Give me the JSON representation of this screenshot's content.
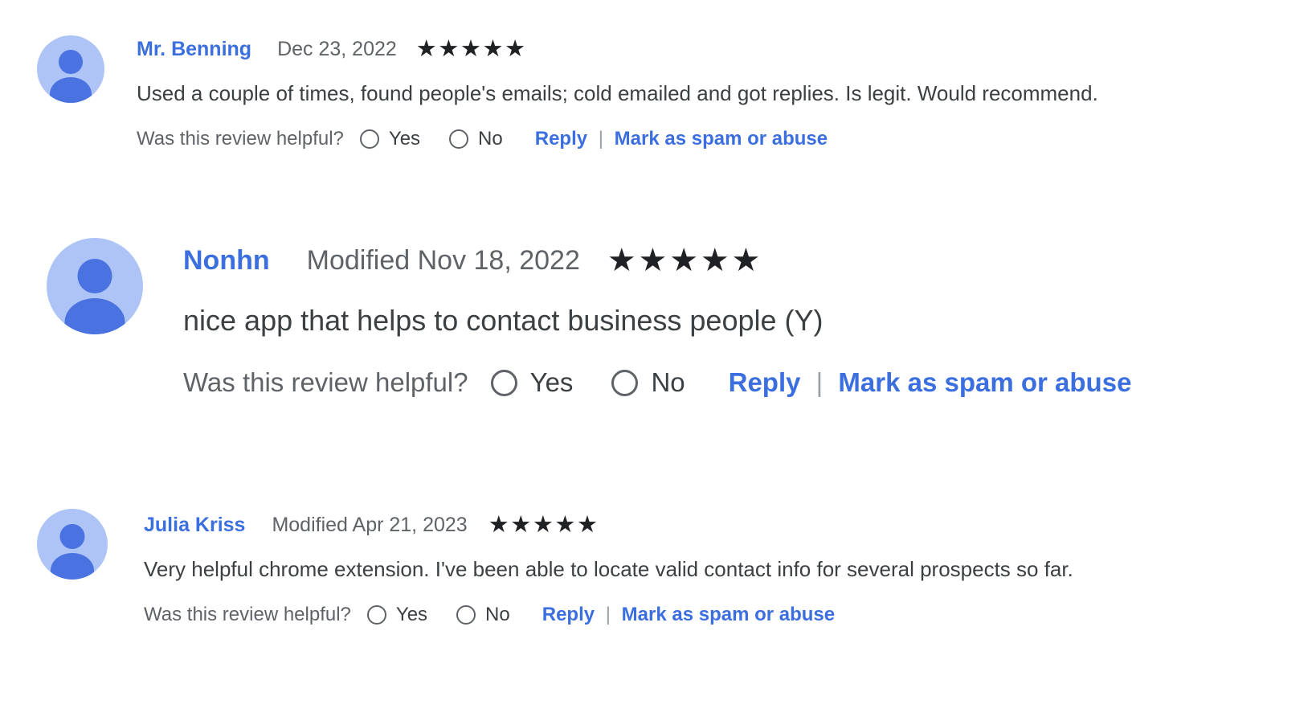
{
  "colors": {
    "link_blue": "#3b6fe0",
    "text_primary": "#3c4043",
    "text_secondary": "#5f6368",
    "star_filled": "#202124",
    "avatar_bg": "#aec4f6",
    "avatar_fg": "#4a72e0",
    "page_bg": "#ffffff"
  },
  "labels": {
    "helpful_question": "Was this review helpful?",
    "yes": "Yes",
    "no": "No",
    "reply": "Reply",
    "separator": "|",
    "mark_spam": "Mark as spam or abuse",
    "star_glyph": "★"
  },
  "reviews": [
    {
      "author": "Mr. Benning",
      "date": "Dec 23, 2022",
      "rating": 5,
      "max_rating": 5,
      "body": "Used a couple of times, found people's emails; cold emailed and got replies. Is legit. Would recommend.",
      "helpful_question": "Was this review helpful?",
      "yes": "Yes",
      "no": "No",
      "reply": "Reply",
      "separator": "|",
      "mark_spam": "Mark as spam or abuse"
    },
    {
      "author": "Nonhn",
      "date": "Modified Nov 18, 2022",
      "rating": 5,
      "max_rating": 5,
      "body": "nice app that helps to contact business people (Y)",
      "helpful_question": "Was this review helpful?",
      "yes": "Yes",
      "no": "No",
      "reply": "Reply",
      "separator": "|",
      "mark_spam": "Mark as spam or abuse"
    },
    {
      "author": "Julia Kriss",
      "date": "Modified Apr 21, 2023",
      "rating": 5,
      "max_rating": 5,
      "body": "Very helpful chrome extension. I've been able to locate valid contact info for several prospects so far.",
      "helpful_question": "Was this review helpful?",
      "yes": "Yes",
      "no": "No",
      "reply": "Reply",
      "separator": "|",
      "mark_spam": "Mark as spam or abuse"
    }
  ]
}
